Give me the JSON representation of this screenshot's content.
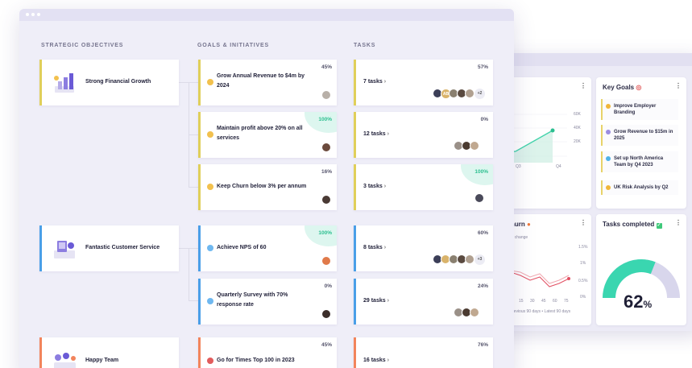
{
  "window": {
    "controls": [
      "dot",
      "dot",
      "dot"
    ]
  },
  "columns": {
    "objectives": "STRATEGIC OBJECTIVES",
    "goals": "GOALS & INITIATIVES",
    "tasks": "TASKS"
  },
  "objectives": [
    {
      "label": "Strong Financial Growth",
      "accent": "#e0cf5a"
    },
    {
      "label": "Fantastic Customer Service",
      "accent": "#4a9fe8"
    },
    {
      "label": "Happy Team",
      "accent": "#f2845c"
    }
  ],
  "goals": [
    {
      "label_l1": "Grow Annual Revenue to $4m by",
      "label_l2": "2024",
      "pct": "45%",
      "highlight": false
    },
    {
      "label_l1": "Maintain profit above 20% on all",
      "label_l2": "services",
      "pct": "100%",
      "highlight": true
    },
    {
      "label_l1": "Keep Churn below 3% per annum",
      "label_l2": "",
      "pct": "16%",
      "highlight": false
    },
    {
      "label_l1": "Achieve NPS of 60",
      "label_l2": "",
      "pct": "100%",
      "highlight": true
    },
    {
      "label_l1": "Quarterly Survey with 70%",
      "label_l2": "response rate",
      "pct": "0%",
      "highlight": false
    },
    {
      "label_l1": "Go for Times Top 100 in 2023",
      "label_l2": "",
      "pct": "45%",
      "highlight": false
    }
  ],
  "tasks": [
    {
      "label": "7 tasks",
      "pct": "57%",
      "highlight": false,
      "initials": "AB",
      "extra": "+2"
    },
    {
      "label": "12 tasks",
      "pct": "0%",
      "highlight": false,
      "initials": "",
      "extra": ""
    },
    {
      "label": "3 tasks",
      "pct": "100%",
      "highlight": true,
      "initials": "",
      "extra": ""
    },
    {
      "label": "8 tasks",
      "pct": "60%",
      "highlight": false,
      "initials": "",
      "extra": "+3"
    },
    {
      "label": "29 tasks",
      "pct": "24%",
      "highlight": false,
      "initials": "",
      "extra": ""
    },
    {
      "label": "16 tasks",
      "pct": "76%",
      "highlight": false,
      "initials": "",
      "extra": ""
    }
  ],
  "chevron": "›",
  "dashboard": {
    "menu": "⋮",
    "chart_ticks": {
      "y": [
        "60K",
        "40K",
        "20K"
      ],
      "x": [
        "Q3",
        "Q4"
      ]
    },
    "key_goals": {
      "title": "Key Goals",
      "items": [
        {
          "l1": "Improve Employer",
          "l2": "Branding"
        },
        {
          "l1": "Grow Revenue to $15m in",
          "l2": "2025"
        },
        {
          "l1": "Set up North America",
          "l2": "Team by Q4 2023"
        },
        {
          "l1": "UK Risk Analysis by Q2",
          "l2": ""
        }
      ]
    },
    "churn": {
      "title": "hurn",
      "subtitle": "t change",
      "y_ticks": [
        "1.5%",
        "1%",
        "0.5%",
        "0%"
      ],
      "x_ticks": [
        "15",
        "30",
        "45",
        "60",
        "75"
      ],
      "legend": "revious 90 days  •  Latest 90 days"
    },
    "tasks_completed": {
      "title": "Tasks completed",
      "value": "62",
      "unit": "%",
      "fraction": 0.62
    }
  }
}
